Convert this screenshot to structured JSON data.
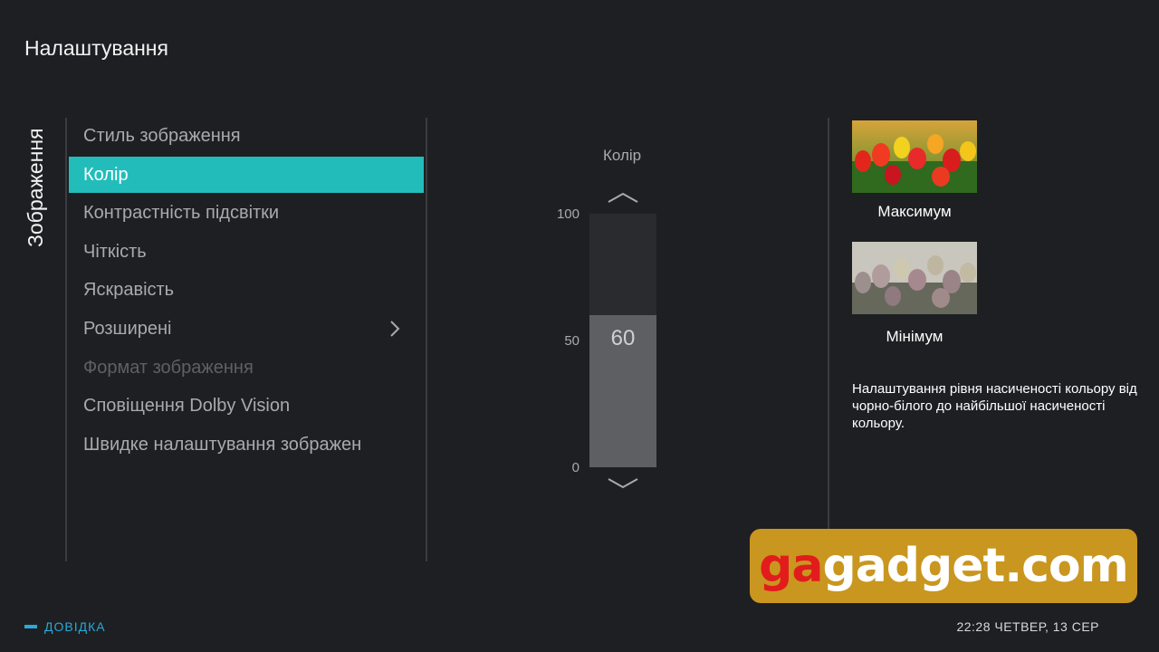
{
  "header": {
    "title": "Налаштування"
  },
  "section_label": "Зображення",
  "menu": {
    "items": [
      {
        "label": "Стиль зображення",
        "state": "normal"
      },
      {
        "label": "Колір",
        "state": "selected"
      },
      {
        "label": "Контрастність підсвітки",
        "state": "normal"
      },
      {
        "label": "Чіткість",
        "state": "normal"
      },
      {
        "label": "Яскравість",
        "state": "normal"
      },
      {
        "label": "Розширені",
        "state": "normal",
        "submenu": true
      },
      {
        "label": "Формат зображення",
        "state": "disabled"
      },
      {
        "label": "Сповіщення Dolby Vision",
        "state": "normal"
      },
      {
        "label": "Швидке налаштування зображен",
        "state": "normal"
      }
    ]
  },
  "slider": {
    "title": "Колір",
    "ticks": {
      "max": "100",
      "mid": "50",
      "min": "0"
    },
    "value": 60,
    "value_label": "60",
    "min": 0,
    "max": 100
  },
  "preview": {
    "max_label": "Максимум",
    "min_label": "Мінімум",
    "description": "Налаштування рівня насиченості кольору від чорно-білого до найбільшої насиченості кольору."
  },
  "watermark": {
    "part1": "ga",
    "part2": "gadget.com"
  },
  "footer": {
    "help_label": "ДОВІДКА",
    "clock": "22:28 ЧЕТВЕР, 13 СЕР"
  },
  "colors": {
    "accent": "#22bdbb",
    "help": "#2aa8d8",
    "background": "#1e1f22"
  }
}
